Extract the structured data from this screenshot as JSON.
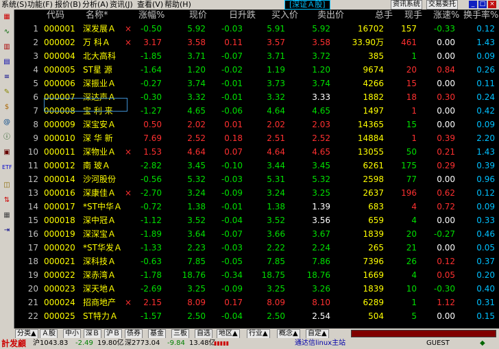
{
  "menu": {
    "items": [
      "系统(S)",
      "功能(F)",
      "报价(B)",
      "分析(A)",
      "资讯(J)",
      "查看(V)",
      "帮助(H)"
    ],
    "market_title": "[深证Ａ股]",
    "btn_news": "资讯系统",
    "btn_trade": "交易委托"
  },
  "table": {
    "headers": [
      "代码",
      "名称*",
      "涨幅%",
      "现价",
      "日升跌",
      "买入价",
      "卖出价",
      "总手",
      "现手",
      "涨速%",
      "换手率%"
    ],
    "rows": [
      {
        "idx": "1",
        "code": "000001",
        "name": "深发展Ａ",
        "mark": "×",
        "pct": "-0.50",
        "price": "5.92",
        "chg": "-0.03",
        "buy": "5.91",
        "sell": "5.92",
        "vol": "16702",
        "cur": "157",
        "speed": "-0.33",
        "turn": "0.12",
        "c": {
          "pct": "green",
          "price": "green",
          "chg": "green",
          "buy": "green",
          "sell": "green",
          "cur": "yellow",
          "speed": "green"
        }
      },
      {
        "idx": "2",
        "code": "000002",
        "name": "万 科Ａ",
        "mark": "×",
        "pct": "3.17",
        "price": "3.58",
        "chg": "0.11",
        "buy": "3.57",
        "sell": "3.58",
        "vol": "33.90万",
        "cur": "461",
        "speed": "0.00",
        "turn": "1.43",
        "c": {
          "pct": "red",
          "price": "red",
          "chg": "red",
          "buy": "red",
          "sell": "red",
          "cur": "red",
          "speed": "white"
        }
      },
      {
        "idx": "3",
        "code": "000004",
        "name": "北大高科",
        "mark": "",
        "pct": "-1.85",
        "price": "3.71",
        "chg": "-0.07",
        "buy": "3.71",
        "sell": "3.72",
        "vol": "385",
        "cur": "1",
        "speed": "0.00",
        "turn": "0.09",
        "c": {
          "pct": "green",
          "price": "green",
          "chg": "green",
          "buy": "green",
          "sell": "green",
          "cur": "green",
          "speed": "white"
        }
      },
      {
        "idx": "4",
        "code": "000005",
        "name": "ST星 源",
        "mark": "",
        "pct": "-1.64",
        "price": "1.20",
        "chg": "-0.02",
        "buy": "1.19",
        "sell": "1.20",
        "vol": "9674",
        "cur": "20",
        "speed": "0.84",
        "turn": "0.26",
        "c": {
          "pct": "green",
          "price": "green",
          "chg": "green",
          "buy": "green",
          "sell": "green",
          "cur": "red",
          "speed": "red"
        }
      },
      {
        "idx": "5",
        "code": "000006",
        "name": "深振业Ａ",
        "mark": "",
        "pct": "-0.27",
        "price": "3.74",
        "chg": "-0.01",
        "buy": "3.73",
        "sell": "3.74",
        "vol": "4266",
        "cur": "15",
        "speed": "0.00",
        "turn": "0.11",
        "c": {
          "pct": "green",
          "price": "green",
          "chg": "green",
          "buy": "green",
          "sell": "green",
          "cur": "red",
          "speed": "white"
        }
      },
      {
        "idx": "6",
        "code": "000007",
        "name": "深达声Ａ",
        "mark": "",
        "pct": "-0.30",
        "price": "3.32",
        "chg": "-0.01",
        "buy": "3.32",
        "sell": "3.33",
        "vol": "1882",
        "cur": "18",
        "speed": "0.30",
        "turn": "0.24",
        "c": {
          "pct": "green",
          "price": "green",
          "chg": "green",
          "buy": "green",
          "sell": "white",
          "cur": "red",
          "speed": "red"
        }
      },
      {
        "idx": "7",
        "code": "000008",
        "name": "宝 利 来",
        "mark": "",
        "pct": "-1.27",
        "price": "4.65",
        "chg": "-0.06",
        "buy": "4.64",
        "sell": "4.65",
        "vol": "1497",
        "cur": "1",
        "speed": "0.00",
        "turn": "0.42",
        "c": {
          "pct": "green",
          "price": "green",
          "chg": "green",
          "buy": "green",
          "sell": "green",
          "cur": "red",
          "speed": "white"
        }
      },
      {
        "idx": "8",
        "code": "000009",
        "name": "深宝安Ａ",
        "mark": "",
        "pct": "0.50",
        "price": "2.02",
        "chg": "0.01",
        "buy": "2.02",
        "sell": "2.03",
        "vol": "14365",
        "cur": "15",
        "speed": "0.00",
        "turn": "0.09",
        "c": {
          "pct": "red",
          "price": "red",
          "chg": "red",
          "buy": "red",
          "sell": "red",
          "cur": "green",
          "speed": "white"
        }
      },
      {
        "idx": "9",
        "code": "000010",
        "name": "深 华 新",
        "mark": "",
        "pct": "7.69",
        "price": "2.52",
        "chg": "0.18",
        "buy": "2.51",
        "sell": "2.52",
        "vol": "14884",
        "cur": "1",
        "speed": "0.39",
        "turn": "2.20",
        "c": {
          "pct": "red",
          "price": "red",
          "chg": "red",
          "buy": "red",
          "sell": "red",
          "cur": "red",
          "speed": "red"
        }
      },
      {
        "idx": "10",
        "code": "000011",
        "name": "深物业Ａ",
        "mark": "×",
        "pct": "1.53",
        "price": "4.64",
        "chg": "0.07",
        "buy": "4.64",
        "sell": "4.65",
        "vol": "13055",
        "cur": "50",
        "speed": "0.21",
        "turn": "1.43",
        "c": {
          "pct": "red",
          "price": "red",
          "chg": "red",
          "buy": "red",
          "sell": "red",
          "cur": "green",
          "speed": "red"
        }
      },
      {
        "idx": "11",
        "code": "000012",
        "name": "南 玻Ａ",
        "mark": "",
        "pct": "-2.82",
        "price": "3.45",
        "chg": "-0.10",
        "buy": "3.44",
        "sell": "3.45",
        "vol": "6261",
        "cur": "175",
        "speed": "0.29",
        "turn": "0.39",
        "c": {
          "pct": "green",
          "price": "green",
          "chg": "green",
          "buy": "green",
          "sell": "green",
          "cur": "green",
          "speed": "red"
        }
      },
      {
        "idx": "12",
        "code": "000014",
        "name": "沙河股份",
        "mark": "",
        "pct": "-0.56",
        "price": "5.32",
        "chg": "-0.03",
        "buy": "5.31",
        "sell": "5.32",
        "vol": "2598",
        "cur": "77",
        "speed": "0.00",
        "turn": "0.96",
        "c": {
          "pct": "green",
          "price": "green",
          "chg": "green",
          "buy": "green",
          "sell": "green",
          "cur": "green",
          "speed": "white"
        }
      },
      {
        "idx": "13",
        "code": "000016",
        "name": "深康佳Ａ",
        "mark": "×",
        "pct": "-2.70",
        "price": "3.24",
        "chg": "-0.09",
        "buy": "3.24",
        "sell": "3.25",
        "vol": "2637",
        "cur": "196",
        "speed": "0.62",
        "turn": "0.12",
        "c": {
          "pct": "green",
          "price": "green",
          "chg": "green",
          "buy": "green",
          "sell": "green",
          "cur": "red",
          "speed": "red"
        }
      },
      {
        "idx": "14",
        "code": "000017",
        "name": "*ST中华Ａ",
        "mark": "",
        "pct": "-0.72",
        "price": "1.38",
        "chg": "-0.01",
        "buy": "1.38",
        "sell": "1.39",
        "vol": "683",
        "cur": "4",
        "speed": "0.72",
        "turn": "0.09",
        "c": {
          "pct": "green",
          "price": "green",
          "chg": "green",
          "buy": "green",
          "sell": "white",
          "cur": "red",
          "speed": "red"
        }
      },
      {
        "idx": "15",
        "code": "000018",
        "name": "深中冠Ａ",
        "mark": "",
        "pct": "-1.12",
        "price": "3.52",
        "chg": "-0.04",
        "buy": "3.52",
        "sell": "3.56",
        "vol": "659",
        "cur": "4",
        "speed": "0.00",
        "turn": "0.33",
        "c": {
          "pct": "green",
          "price": "green",
          "chg": "green",
          "buy": "green",
          "sell": "white",
          "cur": "green",
          "speed": "white"
        }
      },
      {
        "idx": "16",
        "code": "000019",
        "name": "深深宝Ａ",
        "mark": "",
        "pct": "-1.89",
        "price": "3.64",
        "chg": "-0.07",
        "buy": "3.66",
        "sell": "3.67",
        "vol": "1839",
        "cur": "20",
        "speed": "-0.27",
        "turn": "0.46",
        "c": {
          "pct": "green",
          "price": "green",
          "chg": "green",
          "buy": "green",
          "sell": "green",
          "cur": "green",
          "speed": "green"
        }
      },
      {
        "idx": "17",
        "code": "000020",
        "name": "*ST华发Ａ",
        "mark": "",
        "pct": "-1.33",
        "price": "2.23",
        "chg": "-0.03",
        "buy": "2.22",
        "sell": "2.24",
        "vol": "265",
        "cur": "21",
        "speed": "0.00",
        "turn": "0.05",
        "c": {
          "pct": "green",
          "price": "green",
          "chg": "green",
          "buy": "green",
          "sell": "green",
          "cur": "green",
          "speed": "white"
        }
      },
      {
        "idx": "18",
        "code": "000021",
        "name": "深科技Ａ",
        "mark": "",
        "pct": "-0.63",
        "price": "7.85",
        "chg": "-0.05",
        "buy": "7.85",
        "sell": "7.86",
        "vol": "7396",
        "cur": "26",
        "speed": "0.12",
        "turn": "0.37",
        "c": {
          "pct": "green",
          "price": "green",
          "chg": "green",
          "buy": "green",
          "sell": "green",
          "cur": "green",
          "speed": "red"
        }
      },
      {
        "idx": "19",
        "code": "000022",
        "name": "深赤湾Ａ",
        "mark": "",
        "pct": "-1.78",
        "price": "18.76",
        "chg": "-0.34",
        "buy": "18.75",
        "sell": "18.76",
        "vol": "1669",
        "cur": "4",
        "speed": "0.05",
        "turn": "0.20",
        "c": {
          "pct": "green",
          "price": "green",
          "chg": "green",
          "buy": "green",
          "sell": "green",
          "cur": "green",
          "speed": "red"
        }
      },
      {
        "idx": "20",
        "code": "000023",
        "name": "深天地Ａ",
        "mark": "",
        "pct": "-2.69",
        "price": "3.25",
        "chg": "-0.09",
        "buy": "3.25",
        "sell": "3.26",
        "vol": "1839",
        "cur": "10",
        "speed": "-0.30",
        "turn": "0.40",
        "c": {
          "pct": "green",
          "price": "green",
          "chg": "green",
          "buy": "green",
          "sell": "green",
          "cur": "green",
          "speed": "green"
        }
      },
      {
        "idx": "21",
        "code": "000024",
        "name": "招商地产",
        "mark": "×",
        "pct": "2.15",
        "price": "8.09",
        "chg": "0.17",
        "buy": "8.09",
        "sell": "8.10",
        "vol": "6289",
        "cur": "1",
        "speed": "1.12",
        "turn": "0.31",
        "c": {
          "pct": "red",
          "price": "red",
          "chg": "red",
          "buy": "red",
          "sell": "red",
          "cur": "green",
          "speed": "red"
        }
      },
      {
        "idx": "22",
        "code": "000025",
        "name": "ST特力Ａ",
        "mark": "",
        "pct": "-1.57",
        "price": "2.50",
        "chg": "-0.04",
        "buy": "2.50",
        "sell": "2.54",
        "vol": "504",
        "cur": "5",
        "speed": "0.00",
        "turn": "0.15",
        "c": {
          "pct": "green",
          "price": "green",
          "chg": "green",
          "buy": "green",
          "sell": "white",
          "cur": "green",
          "speed": "white"
        }
      }
    ]
  },
  "tabs": [
    "分类▲",
    "Ａ股",
    "中小",
    "深Ｂ",
    "沪Ｂ",
    "债券",
    "基金",
    "三板",
    "自选",
    "地区▲",
    "行业▲",
    "概念▲",
    "自定▲"
  ],
  "status": {
    "logo": "計发顧",
    "sh": "沪1043.83",
    "sh_chg": "-2.49",
    "sh_amt": "19.80亿",
    "sz": "深2773.04",
    "sz_chg": "-9.84",
    "sz_amt": "13.48亿",
    "server": "通达信linux主站",
    "user": "GUEST"
  },
  "colors": {
    "up": "#ff3030",
    "down": "#00e000",
    "code": "#ffff00",
    "turnover": "#00c0ff"
  }
}
